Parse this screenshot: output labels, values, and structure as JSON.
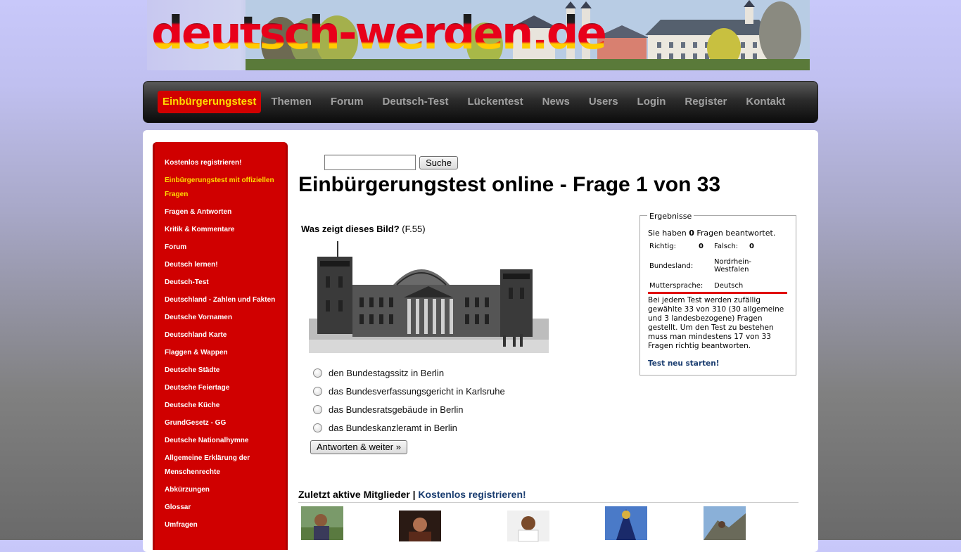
{
  "header": {
    "logo_text": "deutsch-werden.de"
  },
  "nav": {
    "items": [
      {
        "label": "Einbürgerungstest",
        "active": true
      },
      {
        "label": "Themen"
      },
      {
        "label": "Forum"
      },
      {
        "label": "Deutsch-Test"
      },
      {
        "label": "Lückentest"
      },
      {
        "label": "News"
      },
      {
        "label": "Users"
      },
      {
        "label": "Login"
      },
      {
        "label": "Register"
      },
      {
        "label": "Kontakt"
      }
    ]
  },
  "sidebar": {
    "items": [
      {
        "label": "Kostenlos registrieren!"
      },
      {
        "label": "Einbürgerungstest mit offiziellen Fragen",
        "highlight": true
      },
      {
        "label": "Fragen & Antworten"
      },
      {
        "label": "Kritik & Kommentare"
      },
      {
        "label": "Forum"
      },
      {
        "label": "Deutsch lernen!"
      },
      {
        "label": "Deutsch-Test"
      },
      {
        "label": "Deutschland - Zahlen und Fakten"
      },
      {
        "label": "Deutsche Vornamen"
      },
      {
        "label": "Deutschland Karte"
      },
      {
        "label": "Flaggen & Wappen"
      },
      {
        "label": "Deutsche Städte"
      },
      {
        "label": "Deutsche Feiertage"
      },
      {
        "label": "Deutsche Küche"
      },
      {
        "label": "GrundGesetz - GG"
      },
      {
        "label": "Deutsche Nationalhymne"
      },
      {
        "label": "Allgemeine Erklärung der Menschenrechte"
      },
      {
        "label": "Abkürzungen"
      },
      {
        "label": "Glossar"
      },
      {
        "label": "Umfragen"
      }
    ]
  },
  "search": {
    "value": "",
    "button_label": "Suche"
  },
  "main": {
    "title": "Einbürgerungstest online - Frage 1 von 33",
    "question": "Was zeigt dieses Bild?",
    "question_ref": "(F.55)",
    "answers": [
      "den Bundestagssitz in Berlin",
      "das Bundesverfassungsgericht in Karlsruhe",
      "das Bundesratsgebäude in Berlin",
      "das Bundeskanzleramt in Berlin"
    ],
    "submit_label": "Antworten & weiter »"
  },
  "results": {
    "legend": "Ergebnisse",
    "intro_pre": "Sie haben ",
    "answered": "0",
    "intro_post": " Fragen beantwortet.",
    "richtig_label": "Richtig:",
    "richtig_value": "0",
    "falsch_label": "Falsch:",
    "falsch_value": "0",
    "bundesland_label": "Bundesland:",
    "bundesland_value": "Nordrhein-Westfalen",
    "muttersprache_label": "Muttersprache:",
    "muttersprache_value": "Deutsch",
    "info": "Bei jedem Test werden zufällig gewählte 33 von 310 (30 allgemeine und 3 landesbezogene) Fragen gestellt. Um den Test zu bestehen muss man mindestens 17 von 33 Fragen richtig beantworten.",
    "restart_label": "Test neu starten!"
  },
  "members": {
    "title": "Zuletzt aktive Mitglieder",
    "separator": " | ",
    "register_link": "Kostenlos registrieren!"
  },
  "colors": {
    "nav_active_bg": "#d10000",
    "nav_active_text": "#ffdd00",
    "sidebar_bg": "#d00000",
    "link": "#1a3d70"
  }
}
